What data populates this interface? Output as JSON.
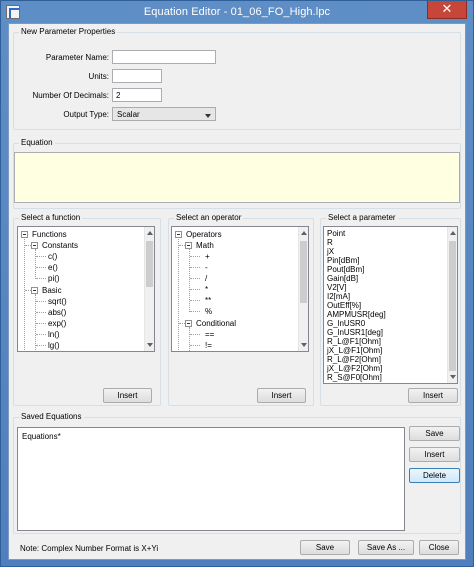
{
  "window": {
    "title": "Equation Editor - 01_06_FO_High.lpc",
    "close_glyph": "✕"
  },
  "new_param": {
    "group_label": "New Parameter Properties",
    "name_label": "Parameter Name:",
    "name_value": "",
    "units_label": "Units:",
    "units_value": "",
    "decimals_label": "Number Of Decimals:",
    "decimals_value": "2",
    "output_type_label": "Output Type:",
    "output_type_value": "Scalar"
  },
  "equation": {
    "group_label": "Equation",
    "value": ""
  },
  "functions": {
    "group_label": "Select a function",
    "root": "Functions",
    "constants": "Constants",
    "constant_items": [
      "c()",
      "e()",
      "pi()"
    ],
    "basic": "Basic",
    "basic_items": [
      "sqrt()",
      "abs()",
      "exp()",
      "ln()",
      "lg()"
    ],
    "insert_label": "Insert"
  },
  "operators": {
    "group_label": "Select an operator",
    "root": "Operators",
    "math": "Math",
    "math_items": [
      "+",
      "-",
      "/",
      "*",
      "**",
      "%"
    ],
    "conditional": "Conditional",
    "conditional_items": [
      "==",
      "!="
    ],
    "insert_label": "Insert"
  },
  "parameters": {
    "group_label": "Select a parameter",
    "items": [
      "Point",
      "R",
      "jX",
      "Pin[dBm]",
      "Pout[dBm]",
      "Gain[dB]",
      "V2[V]",
      "I2[mA]",
      "OutEff[%]",
      "AMPMUSR[deg]",
      "G_lnUSR0",
      "G_lnUSR1[deg]",
      "R_L@F1[Ohm]",
      "jX_L@F1[Ohm]",
      "R_L@F2[Ohm]",
      "jX_L@F2[Ohm]",
      "R_S@F0[Ohm]"
    ],
    "insert_label": "Insert"
  },
  "saved": {
    "group_label": "Saved Equations",
    "items": [
      "Equations*"
    ],
    "save_label": "Save",
    "insert_label": "Insert",
    "delete_label": "Delete"
  },
  "footer": {
    "note": "Note: Complex Number Format is X+Yi",
    "save_label": "Save",
    "save_as_label": "Save As ...",
    "close_label": "Close"
  },
  "colors": {
    "titlebar": "#5a8bc5",
    "close_button": "#c7463a",
    "equation_bg": "#ffffe1"
  }
}
